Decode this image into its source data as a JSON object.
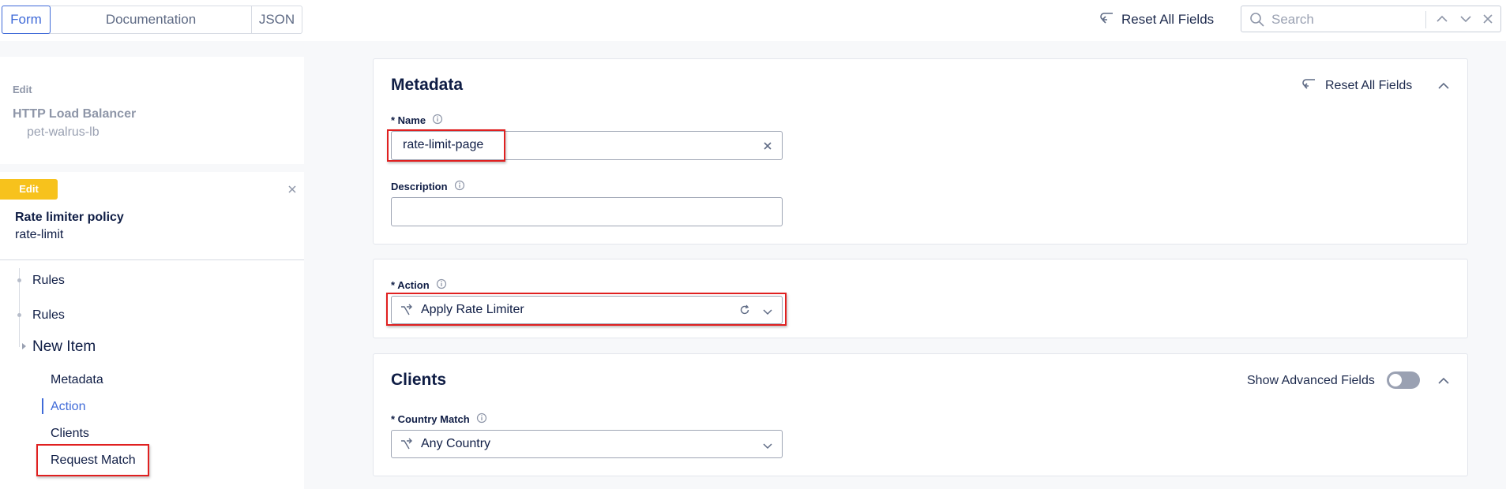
{
  "topbar": {
    "tabs": [
      "Form",
      "Documentation",
      "JSON"
    ],
    "reset_all_label": "Reset All Fields",
    "search_placeholder": "Search"
  },
  "left": {
    "lb": {
      "edit": "Edit",
      "title": "HTTP Load Balancer",
      "name": "pet-walrus-lb"
    },
    "rl": {
      "edit_badge": "Edit",
      "title": "Rate limiter policy",
      "name": "rate-limit"
    },
    "tree": [
      "Rules",
      "Rules",
      "New Item"
    ],
    "sub_items": [
      "Metadata",
      "Action",
      "Clients",
      "Request Match"
    ]
  },
  "metadata": {
    "title": "Metadata",
    "reset_label": "Reset All Fields",
    "name_label": "* Name",
    "name_value": "rate-limit-page",
    "description_label": "Description",
    "description_value": ""
  },
  "action": {
    "label": "* Action",
    "value": "Apply Rate Limiter"
  },
  "clients": {
    "title": "Clients",
    "advanced_label": "Show Advanced Fields",
    "country_label": "* Country Match",
    "country_value": "Any Country"
  },
  "colors": {
    "accent": "#3f6ad8",
    "badge": "#f7c21c",
    "highlight": "#e02020"
  }
}
